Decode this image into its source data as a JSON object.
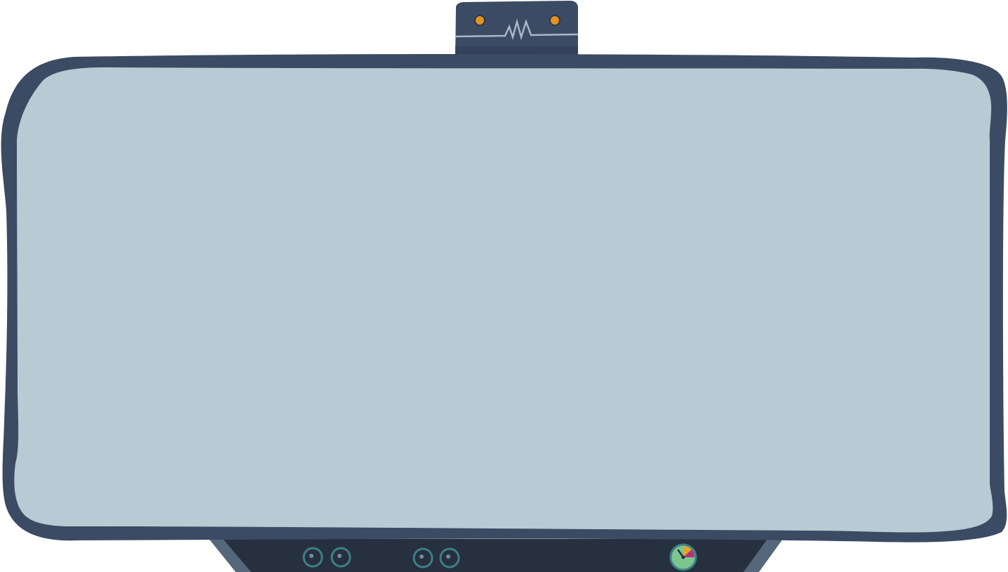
{
  "colors": {
    "frame": "#3c4b64",
    "screen": "#b8cbd4",
    "base": "#26303f",
    "base_legs": "#55677a",
    "top_box": "#3c4b64",
    "lamp": "#e7921e",
    "wave_line": "#aab6c6",
    "knob_ring": "#3d7f86",
    "knob_center": "#6f8fa0",
    "gauge_face": "#7cc58f",
    "gauge_warn": "#e7a32a",
    "gauge_danger": "#b3307a"
  },
  "icons": {
    "top_lamps": [
      "indicator-light-icon",
      "indicator-light-icon"
    ],
    "top_signal": "waveform-icon",
    "knobs": [
      "knob-icon",
      "knob-icon",
      "knob-icon",
      "knob-icon"
    ],
    "gauge": "pressure-gauge-icon"
  }
}
